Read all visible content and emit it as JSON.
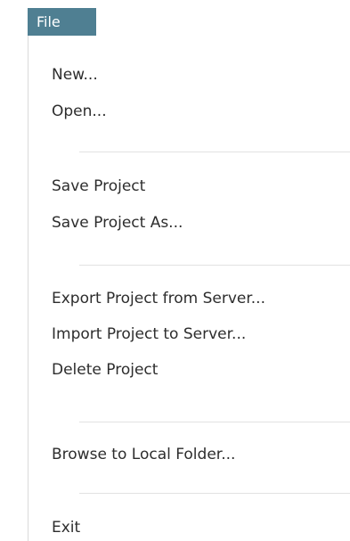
{
  "menu": {
    "title": "File",
    "accent_color": "#4f7f92",
    "items": [
      {
        "label": "New..."
      },
      {
        "label": "Open..."
      },
      {
        "label": "Save Project"
      },
      {
        "label": "Save Project As..."
      },
      {
        "label": "Export Project from Server..."
      },
      {
        "label": "Import Project to Server..."
      },
      {
        "label": "Delete Project"
      },
      {
        "label": "Browse to Local Folder..."
      },
      {
        "label": "Exit"
      }
    ]
  }
}
